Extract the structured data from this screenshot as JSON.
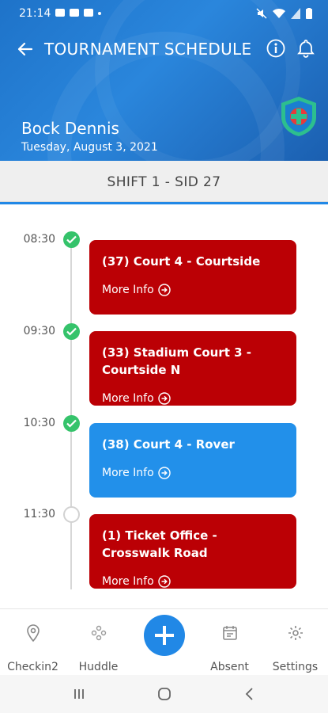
{
  "status_bar": {
    "time": "21:14"
  },
  "header": {
    "title": "TOURNAMENT SCHEDULE",
    "user_name": "Bock Dennis",
    "date": "Tuesday, August 3, 2021"
  },
  "shift": {
    "label": "SHIFT 1 - SID 27"
  },
  "schedule": [
    {
      "time": "08:30",
      "status": "done",
      "title": "(37) Court 4 - Courtside",
      "more": "More Info",
      "color": "#bb0005"
    },
    {
      "time": "09:30",
      "status": "done",
      "title": "(33) Stadium Court 3 - Courtside N",
      "more": "More Info",
      "color": "#bb0005"
    },
    {
      "time": "10:30",
      "status": "done",
      "title": "(38) Court 4 - Rover",
      "more": "More Info",
      "color": "#2290ea"
    },
    {
      "time": "11:30",
      "status": "pending",
      "title": "(1) Ticket Office - Crosswalk Road",
      "more": "More Info",
      "color": "#bb0005"
    }
  ],
  "bottom_nav": {
    "checkin": "Checkin2",
    "huddle": "Huddle",
    "absent": "Absent",
    "settings": "Settings"
  },
  "colors": {
    "accent": "#2188e6",
    "check_green": "#35c36b",
    "card_red": "#bb0005",
    "card_blue": "#2290ea"
  }
}
